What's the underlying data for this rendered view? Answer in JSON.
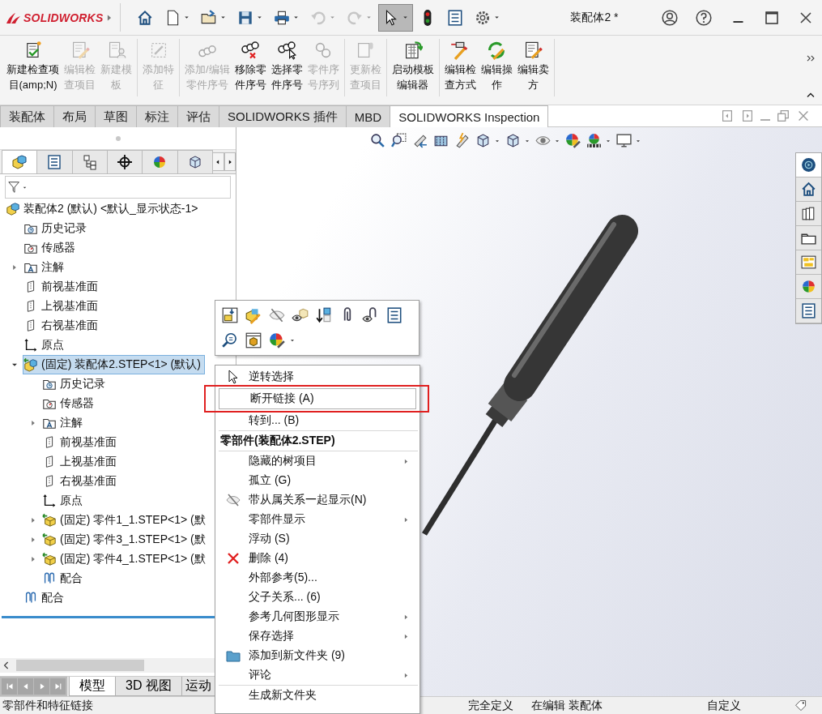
{
  "app": {
    "logo": "SOLIDWORKS",
    "title": "装配体2 *"
  },
  "quick_access": [
    {
      "kind": "home",
      "dropdown": false,
      "disabled": false,
      "pressed": false
    },
    {
      "kind": "doc",
      "dropdown": true,
      "disabled": false,
      "pressed": false
    },
    {
      "kind": "open",
      "dropdown": true,
      "disabled": false,
      "pressed": false
    },
    {
      "kind": "floppy",
      "dropdown": true,
      "disabled": false,
      "pressed": false
    },
    {
      "kind": "printer",
      "dropdown": true,
      "disabled": false,
      "pressed": false
    },
    {
      "kind": "undo",
      "dropdown": true,
      "disabled": true,
      "pressed": false
    },
    {
      "kind": "redo",
      "dropdown": true,
      "disabled": true,
      "pressed": false
    },
    {
      "kind": "cursor",
      "dropdown": true,
      "disabled": false,
      "pressed": true
    },
    {
      "kind": "traffic",
      "dropdown": false,
      "disabled": false,
      "pressed": false
    },
    {
      "kind": "list",
      "dropdown": false,
      "disabled": false,
      "pressed": false
    },
    {
      "kind": "gear",
      "dropdown": true,
      "disabled": false,
      "pressed": false
    }
  ],
  "ribbon": {
    "groups": [
      {
        "buttons": [
          {
            "kind": "check-doc",
            "lines": [
              "新建检查项",
              "目(amp;N)"
            ],
            "disabled": false
          },
          {
            "kind": "pencil-doc",
            "lines": [
              "编辑检",
              "查项目"
            ],
            "disabled": true
          },
          {
            "kind": "template",
            "lines": [
              "新建模",
              "板"
            ],
            "disabled": true
          }
        ]
      },
      {
        "buttons": [
          {
            "kind": "feature",
            "lines": [
              "添加特",
              "征"
            ],
            "disabled": true
          }
        ]
      },
      {
        "buttons": [
          {
            "kind": "balloons",
            "lines": [
              "添加/编辑",
              "零件序号"
            ],
            "disabled": true
          },
          {
            "kind": "balloons-remove",
            "lines": [
              "移除零",
              "件序号"
            ],
            "disabled": false
          },
          {
            "kind": "balloons-select",
            "lines": [
              "选择零",
              "件序号"
            ],
            "disabled": false
          },
          {
            "kind": "balloons-seq",
            "lines": [
              "零件序",
              "号序列"
            ],
            "disabled": true
          }
        ]
      },
      {
        "buttons": [
          {
            "kind": "update-doc",
            "lines": [
              "更新检",
              "查项目"
            ],
            "disabled": true
          }
        ]
      },
      {
        "buttons": [
          {
            "kind": "template-run",
            "lines": [
              "启动模板",
              "编辑器"
            ],
            "disabled": false
          }
        ]
      },
      {
        "buttons": [
          {
            "kind": "probe-pencil",
            "lines": [
              "编辑检",
              "查方式"
            ],
            "disabled": false
          },
          {
            "kind": "cycle-pencil",
            "lines": [
              "编辑操",
              "作"
            ],
            "disabled": false
          },
          {
            "kind": "pencil-doc",
            "lines": [
              "编辑卖",
              "方"
            ],
            "disabled": false
          }
        ]
      }
    ]
  },
  "command_tabs": [
    {
      "label": "装配体",
      "selected": false
    },
    {
      "label": "布局",
      "selected": false
    },
    {
      "label": "草图",
      "selected": false
    },
    {
      "label": "标注",
      "selected": false
    },
    {
      "label": "评估",
      "selected": false
    },
    {
      "label": "SOLIDWORKS 插件",
      "selected": false
    },
    {
      "label": "MBD",
      "selected": false
    },
    {
      "label": "SOLIDWORKS Inspection",
      "selected": true
    }
  ],
  "panel_tabs": [
    {
      "kind": "assembly",
      "selected": true
    },
    {
      "kind": "list",
      "selected": false
    },
    {
      "kind": "config",
      "selected": false
    },
    {
      "kind": "crosshair",
      "selected": false
    },
    {
      "kind": "ball",
      "selected": false
    },
    {
      "kind": "cube",
      "selected": false
    }
  ],
  "tree": {
    "items": [
      {
        "label": "装配体2 (默认) <默认_显示状态-1>",
        "kind": "assembly",
        "selected": false,
        "children": [
          {
            "label": "历史记录",
            "kind": "history",
            "selected": false
          },
          {
            "label": "传感器",
            "kind": "sensor",
            "selected": false
          },
          {
            "label": "注解",
            "kind": "annotation",
            "selected": false,
            "expanded": false
          },
          {
            "label": "前视基准面",
            "kind": "plane",
            "selected": false
          },
          {
            "label": "上视基准面",
            "kind": "plane",
            "selected": false
          },
          {
            "label": "右视基准面",
            "kind": "plane",
            "selected": false
          },
          {
            "label": "原点",
            "kind": "origin",
            "selected": false
          },
          {
            "label": "(固定) 装配体2.STEP<1> (默认)",
            "kind": "assembly-linked",
            "selected": true,
            "expanded": true,
            "children": [
              {
                "label": "历史记录",
                "kind": "history",
                "selected": false
              },
              {
                "label": "传感器",
                "kind": "sensor",
                "selected": false
              },
              {
                "label": "注解",
                "kind": "annotation",
                "selected": false,
                "expanded": false
              },
              {
                "label": "前视基准面",
                "kind": "plane",
                "selected": false
              },
              {
                "label": "上视基准面",
                "kind": "plane",
                "selected": false
              },
              {
                "label": "右视基准面",
                "kind": "plane",
                "selected": false
              },
              {
                "label": "原点",
                "kind": "origin",
                "selected": false
              },
              {
                "label": "(固定) 零件1_1.STEP<1> (默",
                "kind": "part",
                "selected": false,
                "expanded": false
              },
              {
                "label": "(固定) 零件3_1.STEP<1> (默",
                "kind": "part",
                "selected": false,
                "expanded": false
              },
              {
                "label": "(固定) 零件4_1.STEP<1> (默",
                "kind": "part",
                "selected": false,
                "expanded": false
              },
              {
                "label": "配合",
                "kind": "mates",
                "selected": false
              }
            ]
          },
          {
            "label": "配合",
            "kind": "mates",
            "selected": false
          }
        ]
      }
    ]
  },
  "bottom_tabs": [
    {
      "label": "模型",
      "selected": true
    },
    {
      "label": "3D 视图",
      "selected": false
    },
    {
      "label": "运动",
      "selected": false
    }
  ],
  "context_menu": {
    "items": [
      {
        "kind": "cursor",
        "label": "逆转选择",
        "submenu": false,
        "highlighted": false
      },
      {
        "kind": "plain",
        "label": "断开链接 (A)",
        "submenu": false,
        "highlighted": true
      },
      {
        "kind": "plain",
        "label": "转到... (B)",
        "submenu": false,
        "highlighted": false
      },
      {
        "kind": "separator"
      },
      {
        "kind": "header",
        "label": "零部件(装配体2.STEP)"
      },
      {
        "kind": "separator"
      },
      {
        "kind": "plain",
        "label": "隐藏的树项目",
        "submenu": true,
        "highlighted": false
      },
      {
        "kind": "plain",
        "label": "孤立 (G)",
        "submenu": false,
        "highlighted": false
      },
      {
        "kind": "hidden",
        "label": "带从属关系一起显示(N)",
        "submenu": false,
        "highlighted": false
      },
      {
        "kind": "plain",
        "label": "零部件显示",
        "submenu": true,
        "highlighted": false
      },
      {
        "kind": "plain",
        "label": "浮动 (S)",
        "submenu": false,
        "highlighted": false
      },
      {
        "kind": "delete",
        "label": "删除 (4)",
        "submenu": false,
        "highlighted": false
      },
      {
        "kind": "plain",
        "label": "外部参考(5)...",
        "submenu": false,
        "highlighted": false
      },
      {
        "kind": "plain",
        "label": "父子关系... (6)",
        "submenu": false,
        "highlighted": false
      },
      {
        "kind": "plain",
        "label": "参考几何图形显示",
        "submenu": true,
        "highlighted": false
      },
      {
        "kind": "plain",
        "label": "保存选择",
        "submenu": true,
        "highlighted": false
      },
      {
        "kind": "folder",
        "label": "添加到新文件夹 (9)",
        "submenu": false,
        "highlighted": false
      },
      {
        "kind": "plain",
        "label": "评论",
        "submenu": true,
        "highlighted": false
      },
      {
        "kind": "separator"
      },
      {
        "kind": "plain",
        "label": "生成新文件夹",
        "submenu": false,
        "highlighted": false
      }
    ]
  },
  "status_bar": {
    "hint": "零部件和特征链接",
    "fields": [
      "完全定义",
      "在编辑 装配体",
      "自定义"
    ]
  }
}
